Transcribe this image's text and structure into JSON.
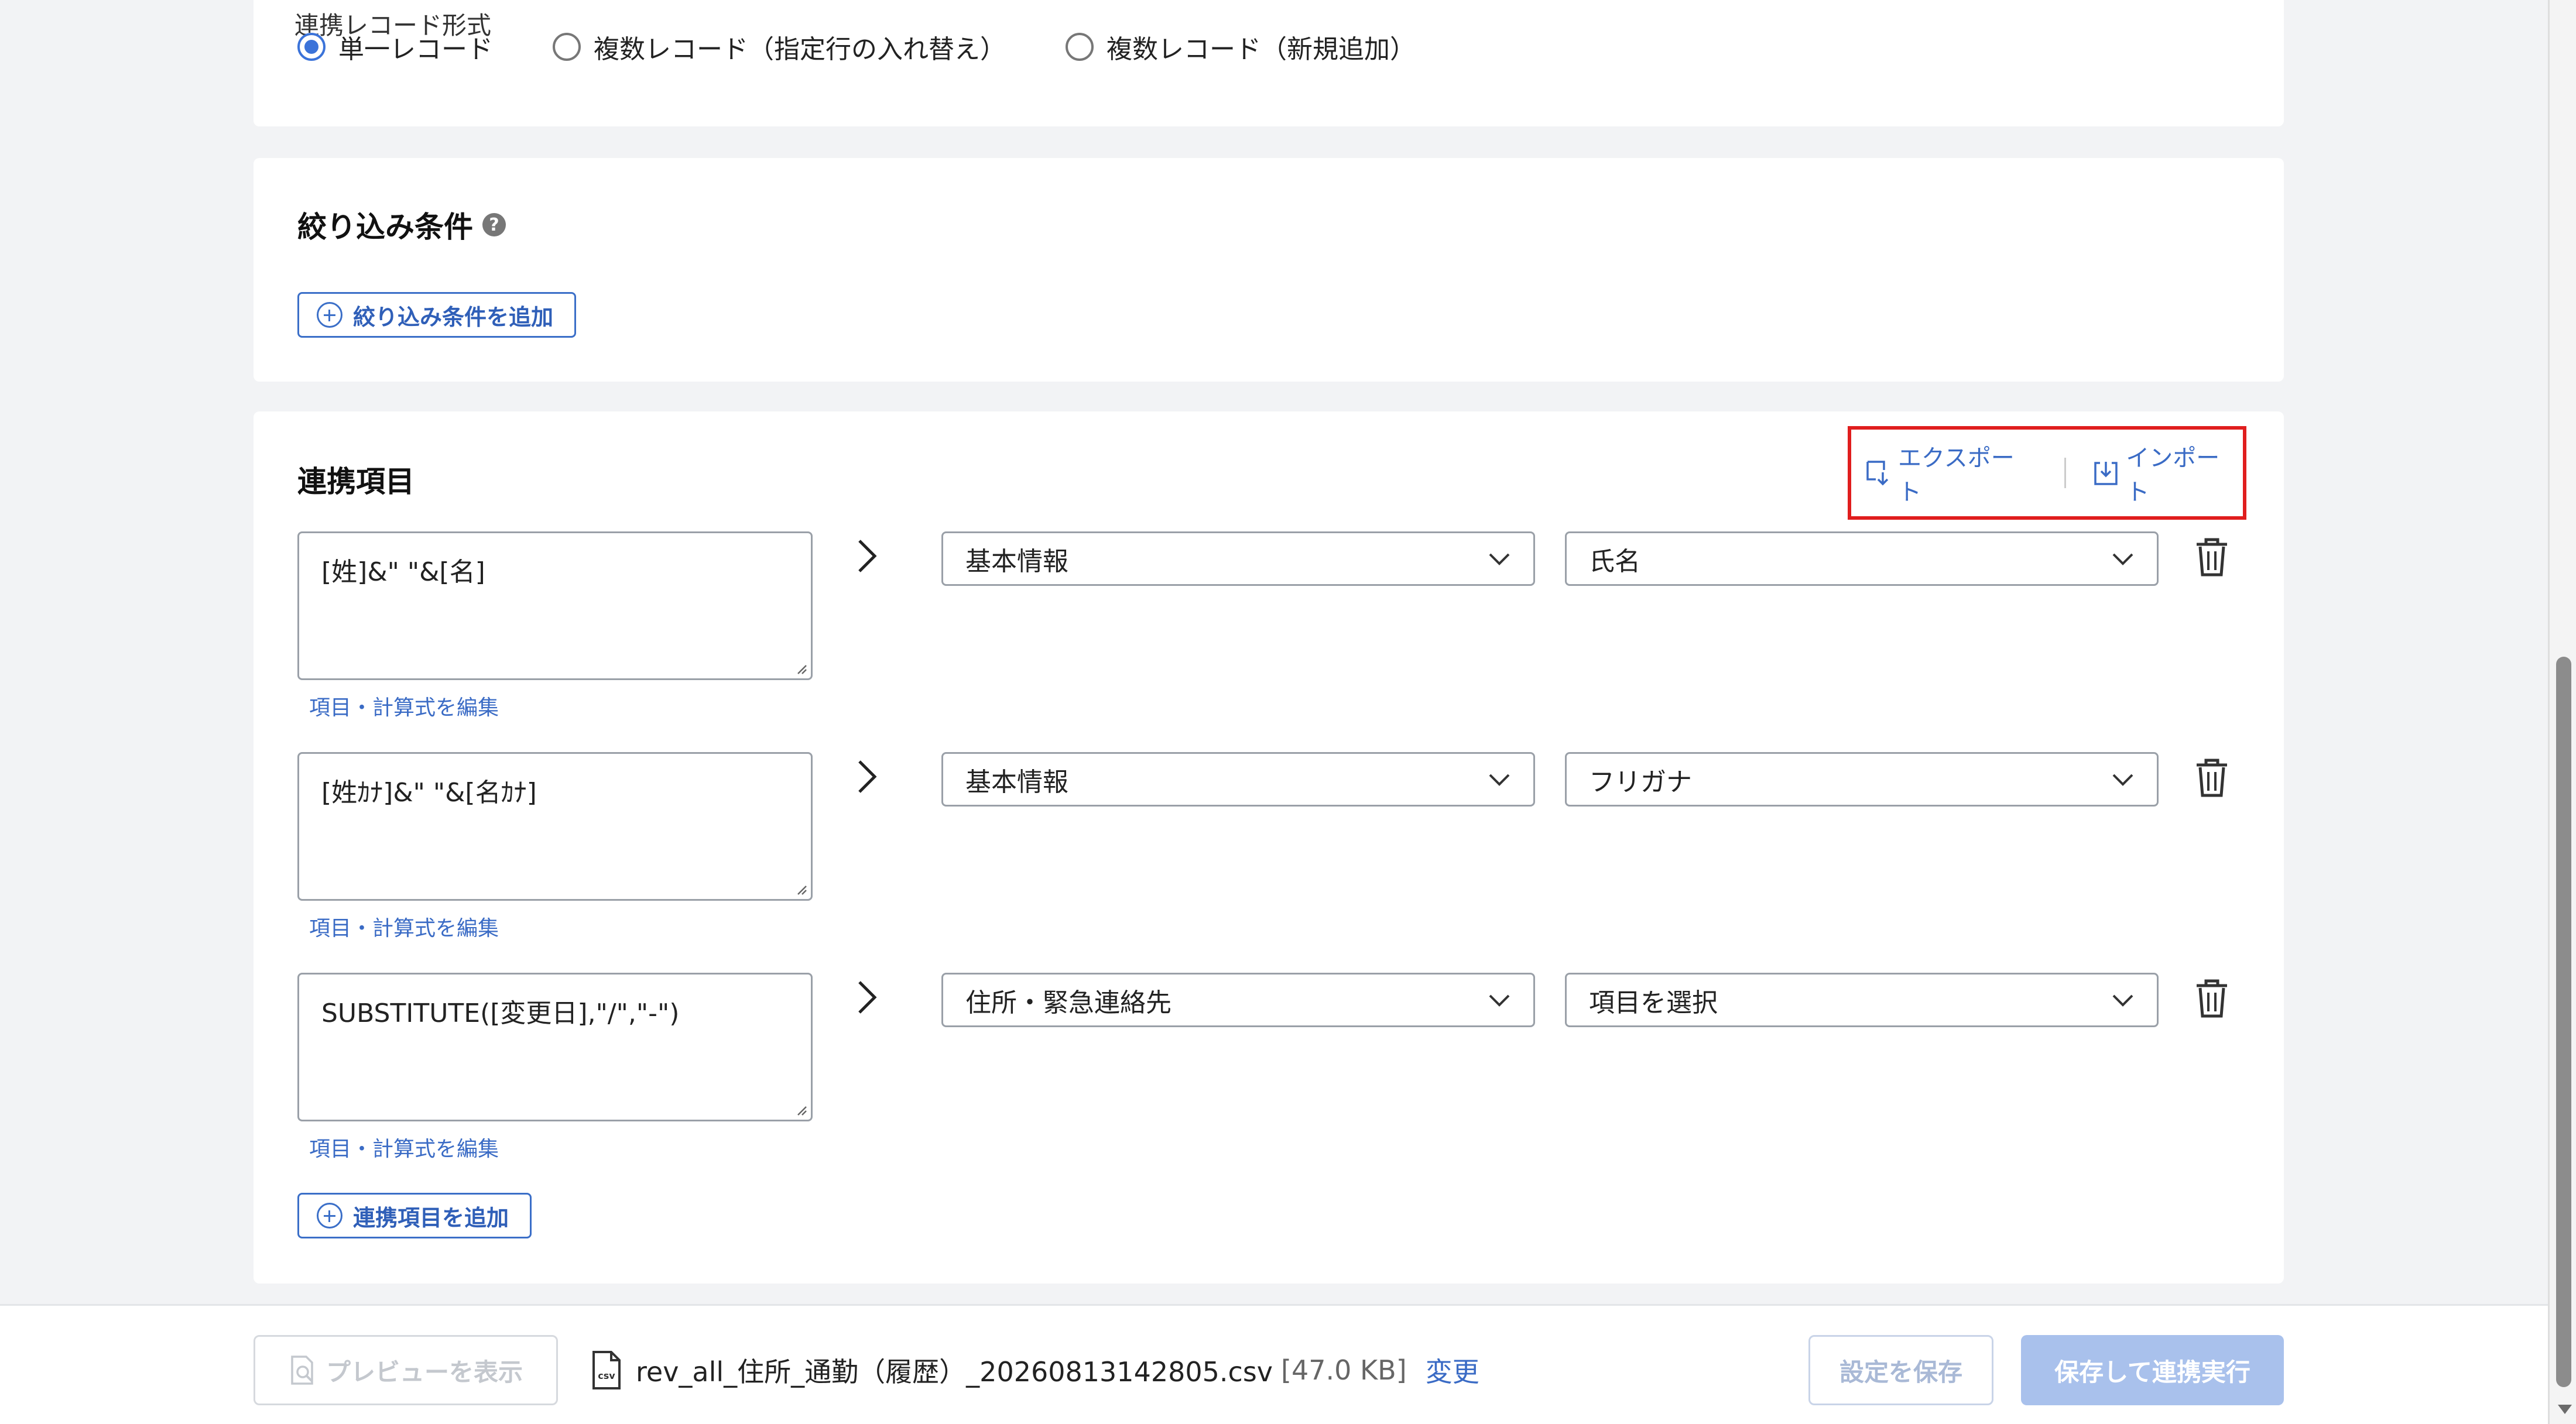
{
  "record_format": {
    "label": "連携レコード形式",
    "options": [
      {
        "label": "単一レコード",
        "selected": true
      },
      {
        "label": "複数レコード（指定行の入れ替え）",
        "selected": false
      },
      {
        "label": "複数レコード（新規追加）",
        "selected": false
      }
    ]
  },
  "filter": {
    "title": "絞り込み条件",
    "help": "?",
    "add_label": "絞り込み条件を追加"
  },
  "mapping": {
    "title": "連携項目",
    "export_label": "エクスポート",
    "import_label": "インポート",
    "edit_link": "項目・計算式を編集",
    "add_label": "連携項目を追加",
    "rows": [
      {
        "formula": "[姓]&\" \"&[名]",
        "category": "基本情報",
        "field": "氏名"
      },
      {
        "formula": "[姓ｶﾅ]&\" \"&[名ｶﾅ]",
        "category": "基本情報",
        "field": "フリガナ"
      },
      {
        "formula": "SUBSTITUTE([変更日],\"/\",\"-\")",
        "category": "住所・緊急連絡先",
        "field": "項目を選択"
      }
    ]
  },
  "footer": {
    "preview_label": "プレビューを表示",
    "file_name": "rev_all_住所_通勤（履歴）_20260813142805.csv",
    "file_size": "[47.0 KB]",
    "change_label": "変更",
    "save_label": "設定を保存",
    "run_label": "保存して連携実行"
  },
  "colors": {
    "accent": "#3b73d9",
    "link": "#3a6bc5",
    "highlight_border": "#e01e1e",
    "disabled_primary": "#a9c1ec"
  }
}
